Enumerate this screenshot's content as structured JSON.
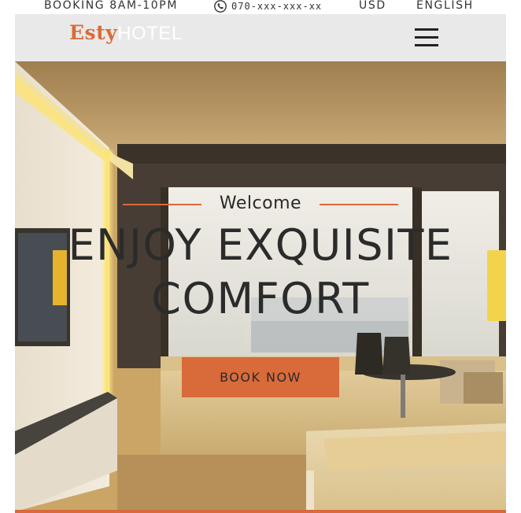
{
  "topbar": {
    "booking": "BOOKING 8AM-10PM",
    "phone": "070-xxx-xxx-xx",
    "phone_icon": "phone-icon",
    "currency": "USD",
    "language": "ENGLISH"
  },
  "header": {
    "logo_brand": "Esty",
    "logo_suffix": "HOTEL",
    "menu_icon": "hamburger-menu-icon"
  },
  "hero": {
    "welcome": "Welcome",
    "headline_line1": "ENJOY EXQUISITE",
    "headline_line2": "COMFORT",
    "cta_label": "BOOK NOW"
  },
  "colors": {
    "accent": "#d96a3a",
    "header_bg": "#e9e9e9",
    "text_dark": "#2b2b2b"
  }
}
